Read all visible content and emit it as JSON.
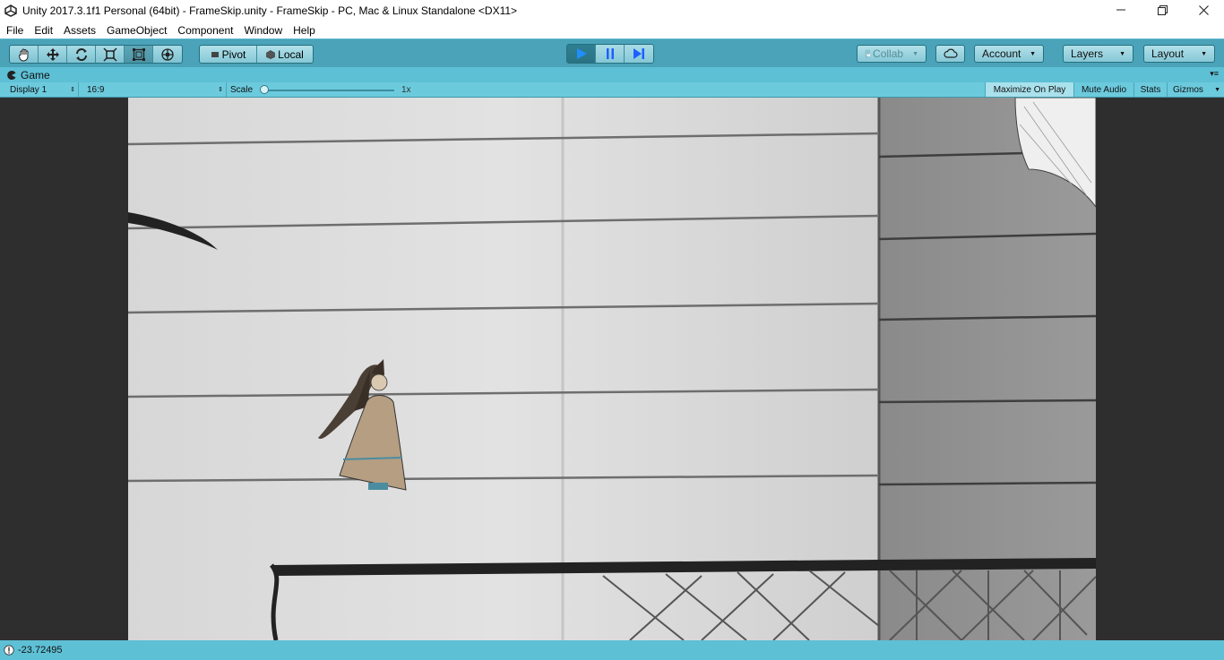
{
  "window": {
    "title": "Unity 2017.3.1f1 Personal (64bit) - FrameSkip.unity - FrameSkip - PC, Mac & Linux Standalone <DX11>",
    "minimize_icon": "minimize-icon",
    "maximize_icon": "restore-icon",
    "close_icon": "close-icon"
  },
  "menu": [
    "File",
    "Edit",
    "Assets",
    "GameObject",
    "Component",
    "Window",
    "Help"
  ],
  "toolbar": {
    "tools": [
      "hand-icon",
      "move-icon",
      "rotate-icon",
      "scale-icon",
      "rect-tool-icon",
      "transform-tool-icon"
    ],
    "active_tool": "rect-tool-icon",
    "pivot_label": "Pivot",
    "local_label": "Local",
    "collab_label": "Collab",
    "account_label": "Account",
    "layers_label": "Layers",
    "layout_label": "Layout",
    "play_state": "playing"
  },
  "game_panel": {
    "tab_label": "Game",
    "display": "Display 1",
    "aspect": "16:9",
    "scale_label": "Scale",
    "scale_value": "1x",
    "scale_fraction": 0,
    "maximize_on_play": "Maximize On Play",
    "mute_audio": "Mute Audio",
    "stats": "Stats",
    "gizmos": "Gizmos"
  },
  "status": {
    "message": "-23.72495",
    "icon": "info-icon"
  },
  "colors": {
    "toolbar": "#4aa3b8",
    "panel": "#5ec0d5",
    "game_background": "#2e2e2e"
  }
}
